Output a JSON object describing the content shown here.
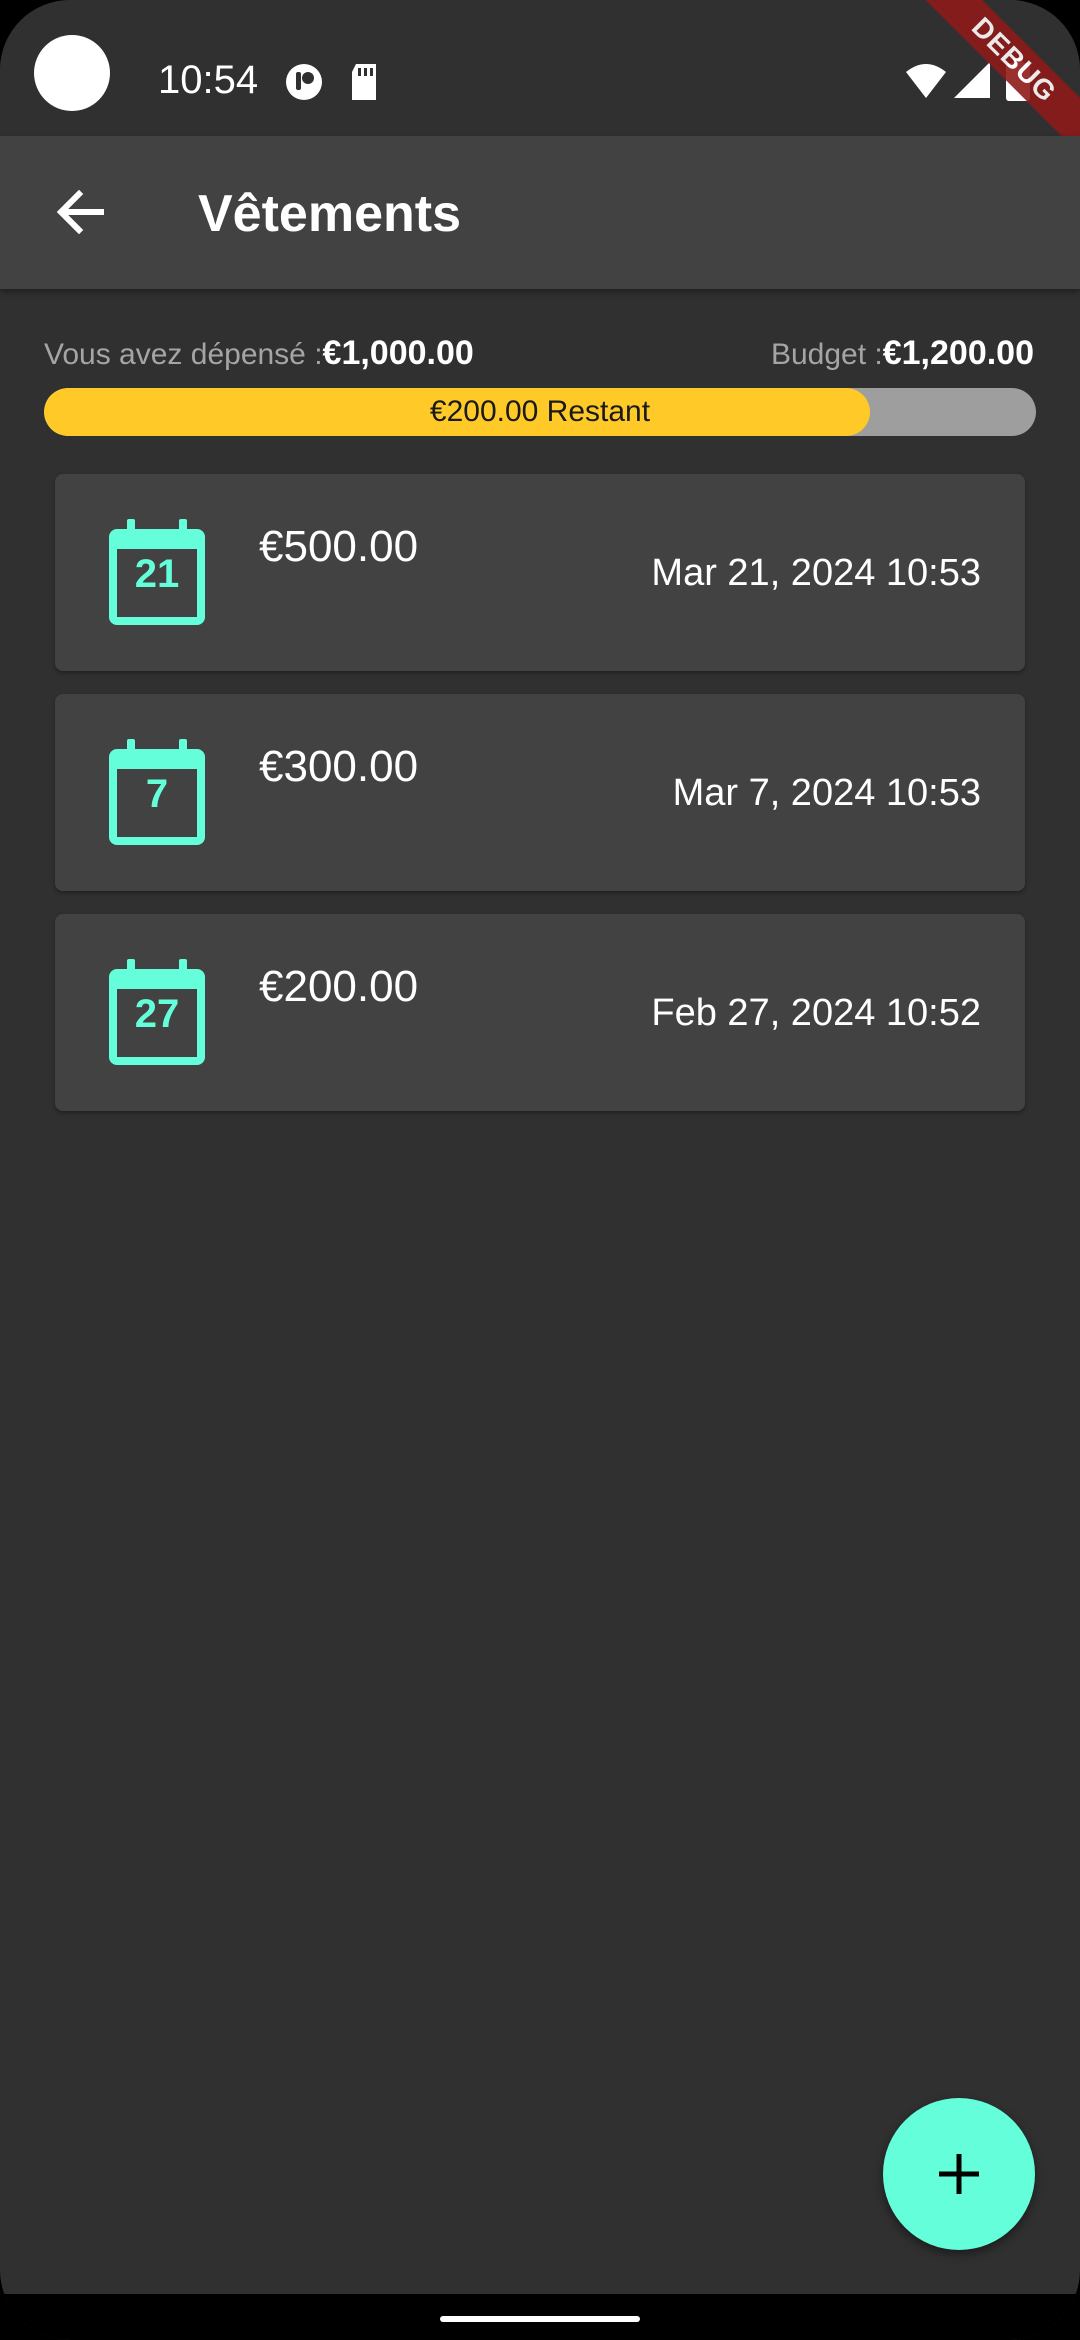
{
  "status_bar": {
    "time": "10:54",
    "icons": [
      "circle-app-icon",
      "sd-card-icon",
      "wifi-icon",
      "signal-icon",
      "battery-icon"
    ],
    "debug_banner": "DEBUG"
  },
  "app_bar": {
    "back_icon": "arrow-back-icon",
    "title": "Vêtements"
  },
  "summary": {
    "spent_label": "Vous avez dépensé :",
    "spent_amount": "€1,000.00",
    "budget_label": "Budget :",
    "budget_amount": "€1,200.00",
    "progress_fraction": 0.833,
    "remaining_label": "€200.00 Restant"
  },
  "expenses": [
    {
      "day": "21",
      "amount": "€500.00",
      "date": "Mar 21, 2024 10:53"
    },
    {
      "day": "7",
      "amount": "€300.00",
      "date": "Mar 7, 2024 10:53"
    },
    {
      "day": "27",
      "amount": "€200.00",
      "date": "Feb 27, 2024 10:52"
    }
  ],
  "fab": {
    "icon": "plus-icon"
  },
  "colors": {
    "background": "#303030",
    "surface": "#424242",
    "accent": "#64ffda",
    "progress": "#ffca28",
    "track": "#9e9e9e",
    "debug": "#8e1b1b"
  }
}
